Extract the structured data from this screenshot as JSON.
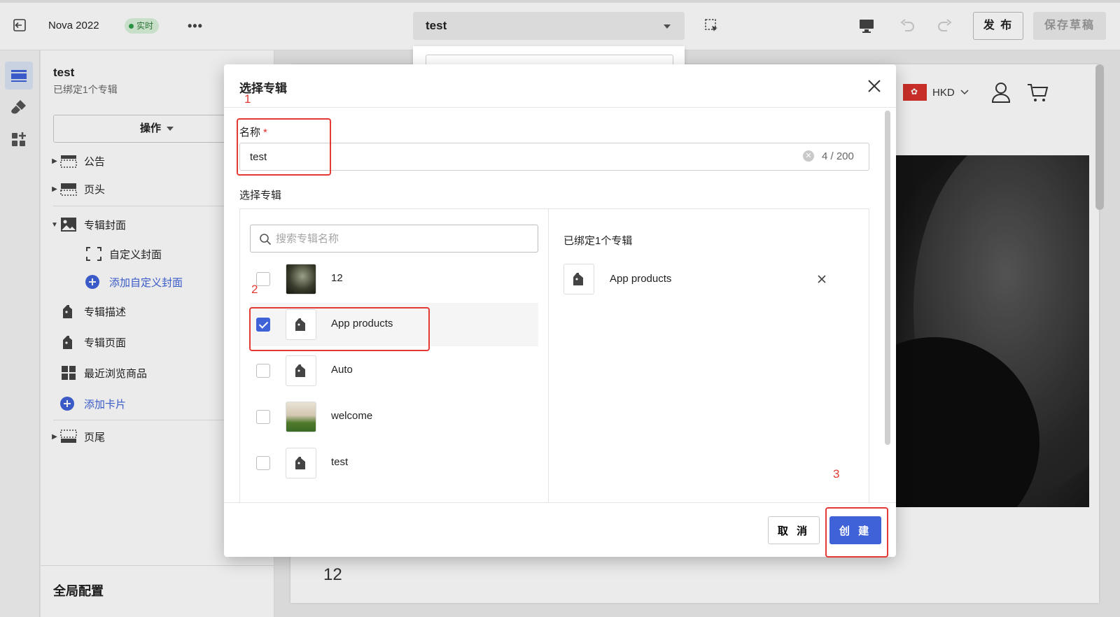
{
  "topbar": {
    "app_title": "Nova 2022",
    "live_badge": "实时",
    "more": "•••",
    "page_select": "test",
    "publish_label": "发 布",
    "save_draft_label": "保存草稿"
  },
  "panel": {
    "title": "test",
    "subtitle": "已绑定1个专辑",
    "operate_label": "操作",
    "tree": {
      "announcement": "公告",
      "header": "页头",
      "album_cover": "专辑封面",
      "custom_cover": "自定义封面",
      "add_custom_cover": "添加自定义封面",
      "album_description": "专辑描述",
      "album_page": "专辑页面",
      "recently_viewed": "最近浏览商品",
      "add_card": "添加卡片",
      "footer": "页尾"
    },
    "global_config": "全局配置"
  },
  "preview": {
    "currency": "HKD",
    "bottom_text": "12"
  },
  "modal": {
    "title": "选择专辑",
    "name_label": "名称",
    "required_mark": "*",
    "name_value": "test",
    "name_count": "4 / 200",
    "select_label": "选择专辑",
    "search_placeholder": "搜索专辑名称",
    "albums": [
      {
        "name": "12",
        "checked": false,
        "thumb": "photo"
      },
      {
        "name": "App products",
        "checked": true,
        "thumb": "tag-icon"
      },
      {
        "name": "Auto",
        "checked": false,
        "thumb": "tag-icon"
      },
      {
        "name": "welcome",
        "checked": false,
        "thumb": "photo"
      },
      {
        "name": "test",
        "checked": false,
        "thumb": "tag-icon"
      }
    ],
    "bound_title": "已绑定1个专辑",
    "bound_items": [
      {
        "name": "App products"
      }
    ],
    "cancel_label": "取 消",
    "create_label": "创 建"
  },
  "annotations": [
    "1",
    "2",
    "3"
  ],
  "colors": {
    "accent": "#3f62d9",
    "annotation": "#e53935",
    "live_badge_bg": "#d9f2dc"
  }
}
